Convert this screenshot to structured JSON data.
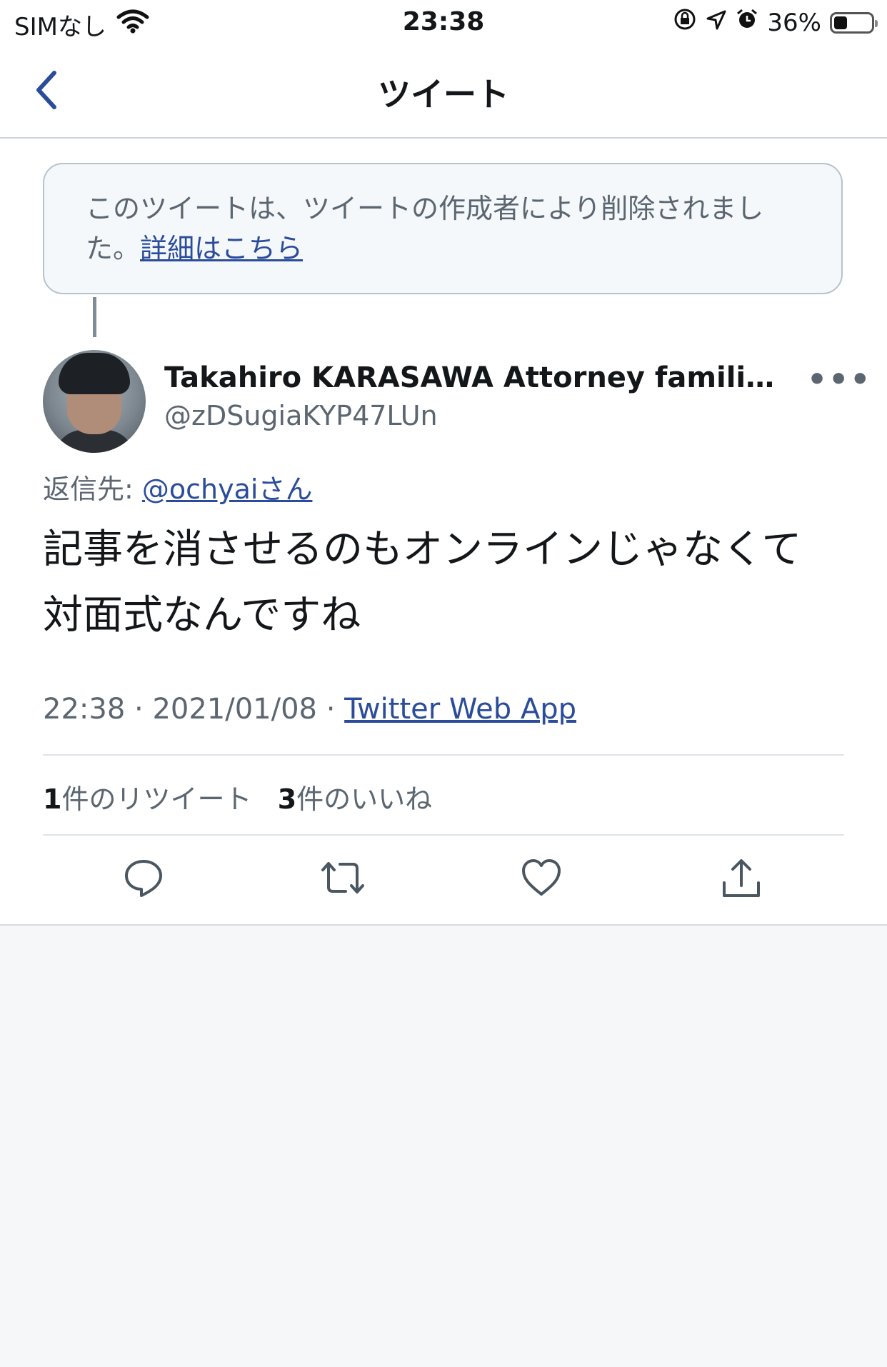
{
  "status_bar": {
    "carrier": "SIMなし",
    "time": "23:38",
    "battery": "36%",
    "battery_level": 0.36,
    "icons": [
      "wifi-icon",
      "orientation-lock-icon",
      "location-icon",
      "alarm-icon",
      "battery-icon"
    ]
  },
  "nav": {
    "title": "ツイート",
    "back_icon": "chevron-left-icon"
  },
  "deleted_notice": {
    "text": "このツイートは、ツイートの作成者により削除されました。",
    "link": "詳細はこちら"
  },
  "tweet": {
    "author_name": "Takahiro KARASAWA Attorney familiar wit...",
    "handle": "@zDSugiaKYP47LUn",
    "reply_label": "返信先: ",
    "reply_to": "@ochyaiさん",
    "text_line1": "記事を消させるのもオンラインじゃなくて",
    "text_line2": "対面式なんですね",
    "time": "22:38",
    "date": "2021/01/08",
    "separator": " · ",
    "source": "Twitter Web App"
  },
  "stats": {
    "retweets_count": "1",
    "retweets_label": "件のリツイート",
    "likes_count": "3",
    "likes_label": "件のいいね"
  },
  "colors": {
    "link": "#2b4c9b",
    "secondary_text": "#5b6670",
    "background": "#f5f7f9"
  }
}
